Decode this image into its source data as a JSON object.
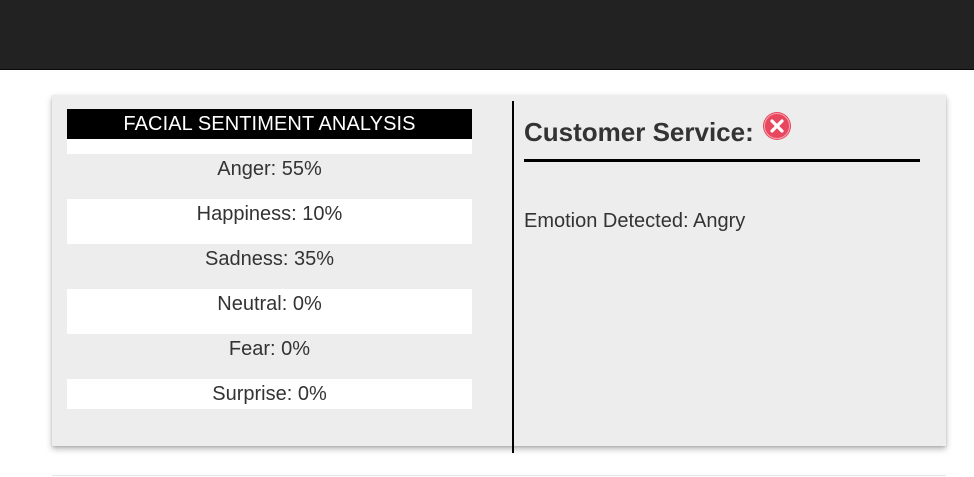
{
  "analysis": {
    "title": "FACIAL SENTIMENT ANALYSIS",
    "rows": [
      {
        "label": "Anger: 55%"
      },
      {
        "label": "Happiness: 10%"
      },
      {
        "label": "Sadness: 35%"
      },
      {
        "label": "Neutral: 0%"
      },
      {
        "label": "Fear: 0%"
      },
      {
        "label": "Surprise: 0%"
      }
    ]
  },
  "customer_service": {
    "title": "Customer Service:",
    "status_icon": "x-circle-icon",
    "status_color": "#e8485e",
    "emotion_text": "Emotion Detected: Angry"
  }
}
